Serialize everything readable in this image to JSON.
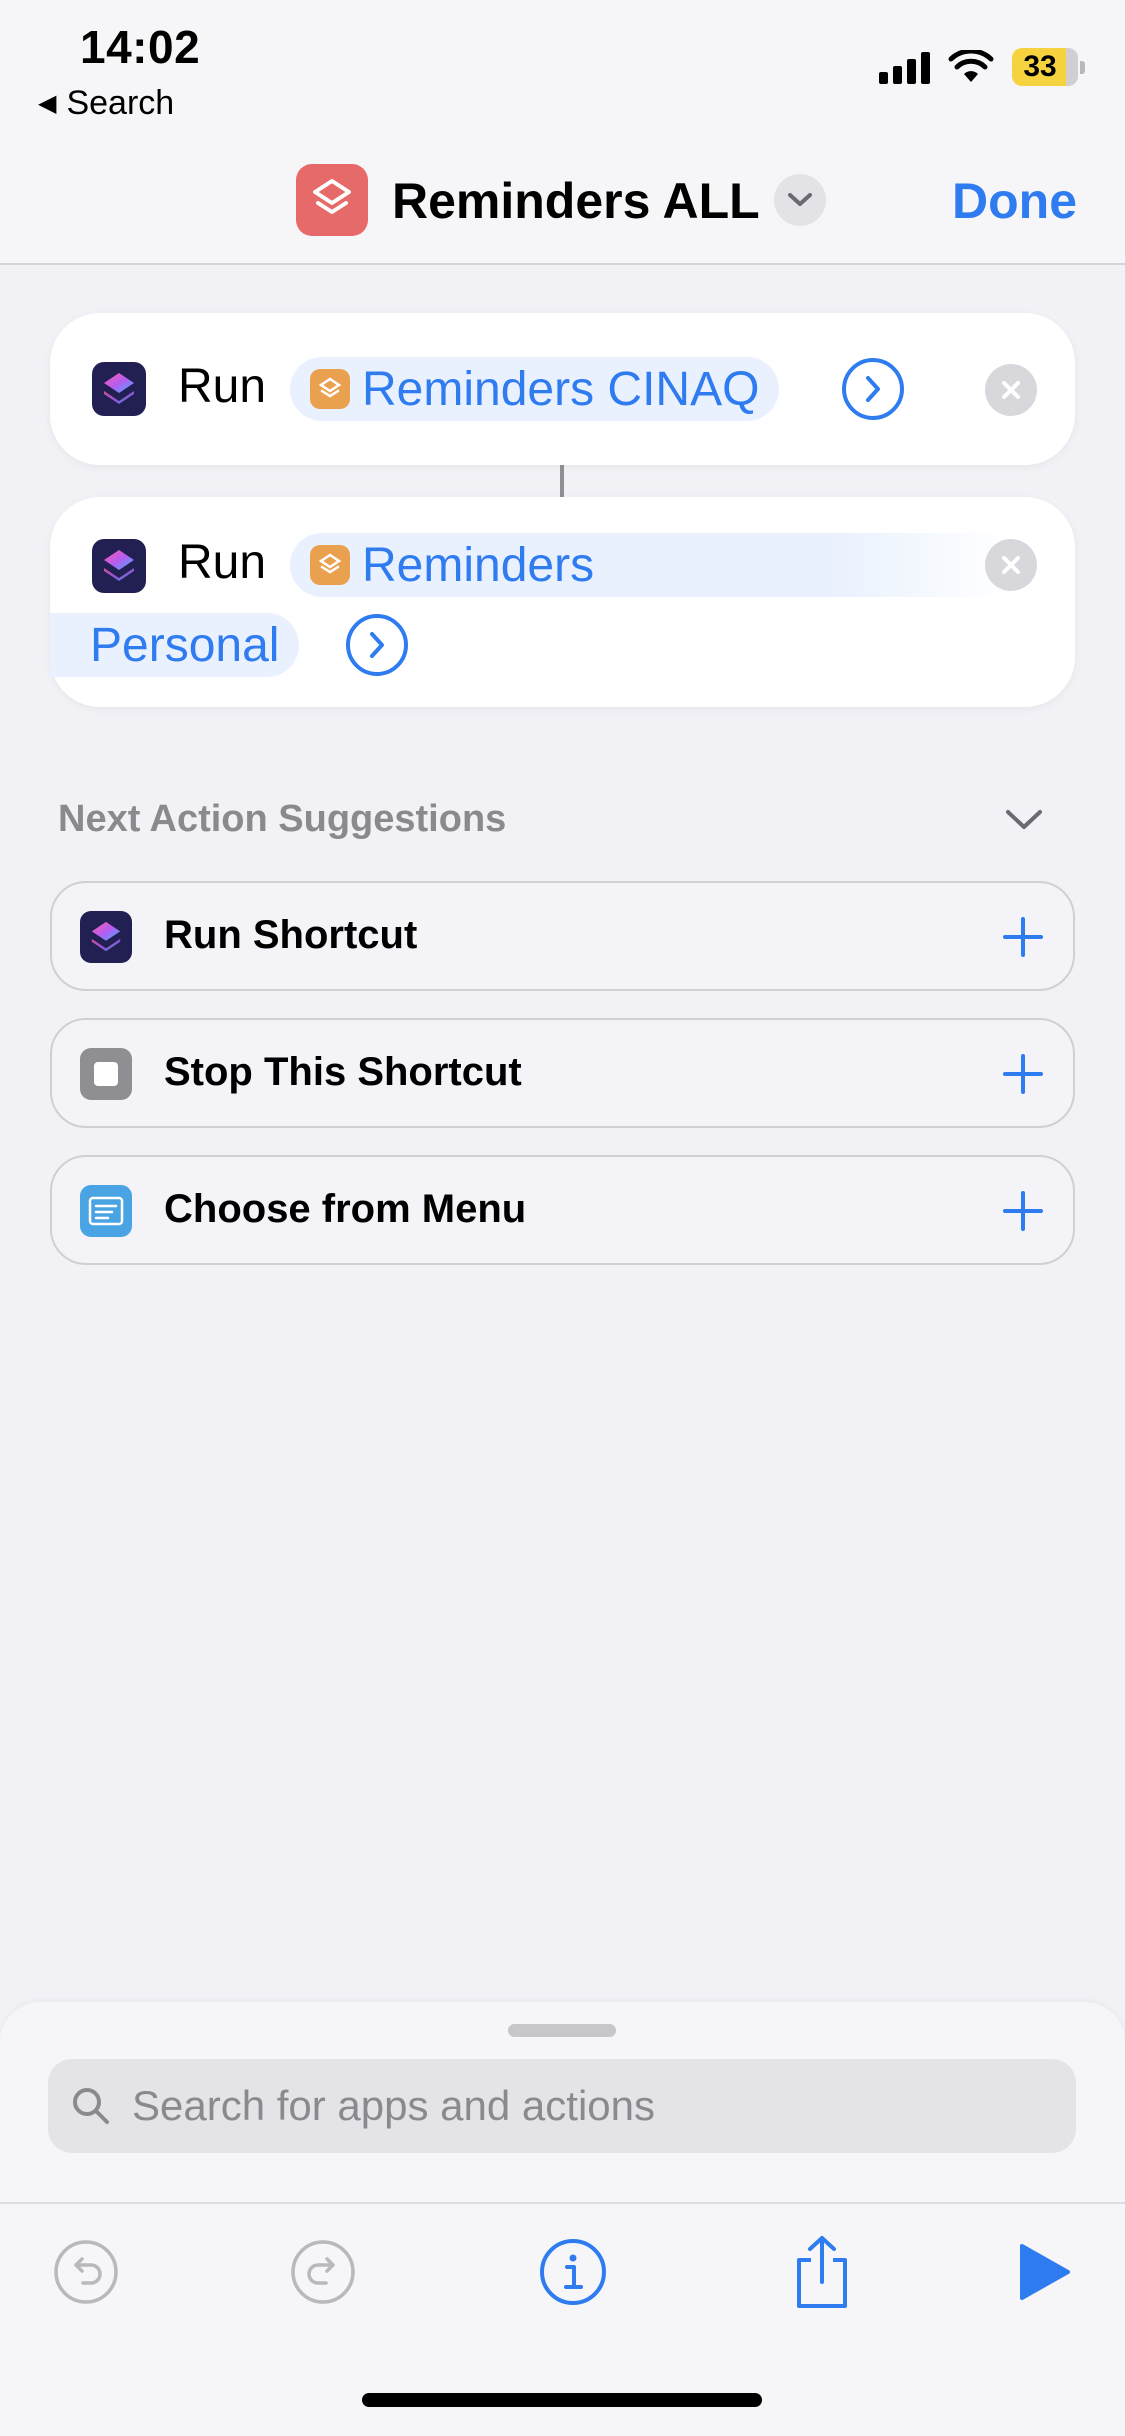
{
  "status_bar": {
    "time": "14:02",
    "back_label": "Search",
    "battery": "33",
    "icons": [
      "signal-icon",
      "wifi-icon",
      "battery-icon"
    ]
  },
  "header": {
    "title": "Reminders ALL",
    "done_label": "Done",
    "app_icon": "shortcuts-layers-icon",
    "app_icon_color": "#e76a6a"
  },
  "actions": [
    {
      "verb": "Run",
      "shortcut": "Reminders CINAQ"
    },
    {
      "verb": "Run",
      "shortcut_line1": "Reminders",
      "shortcut_line2": "Personal"
    }
  ],
  "suggestions": {
    "title": "Next Action Suggestions",
    "items": [
      {
        "label": "Run Shortcut",
        "icon": "shortcuts-icon"
      },
      {
        "label": "Stop This Shortcut",
        "icon": "stop-icon"
      },
      {
        "label": "Choose from Menu",
        "icon": "menu-icon"
      }
    ]
  },
  "search": {
    "placeholder": "Search for apps and actions"
  },
  "toolbar": {
    "buttons": [
      "undo-icon",
      "redo-icon",
      "info-icon",
      "share-icon",
      "play-icon"
    ]
  },
  "colors": {
    "accent": "#2f7bf0",
    "background": "#f1f1f6",
    "token_bg": "#e9f1fe",
    "token_icon": "#eaa14f",
    "run_icon_bg": "#221f52"
  }
}
